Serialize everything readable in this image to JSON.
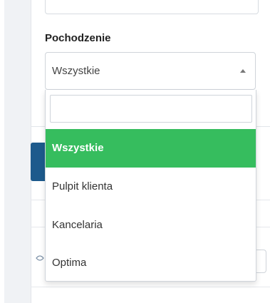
{
  "filter": {
    "label": "Pochodzenie",
    "selected_value": "Wszystkie",
    "search_value": "",
    "options": [
      {
        "label": "Wszystkie",
        "selected": true
      },
      {
        "label": "Pulpit klienta",
        "selected": false
      },
      {
        "label": "Kancelaria",
        "selected": false
      },
      {
        "label": "Optima",
        "selected": false
      }
    ]
  },
  "colors": {
    "selected_option_bg": "#36bd5e",
    "primary_button": "#1d5a8c"
  },
  "icons": {
    "select_arrow": "caret-up-icon",
    "background_eye": "eye-icon"
  }
}
